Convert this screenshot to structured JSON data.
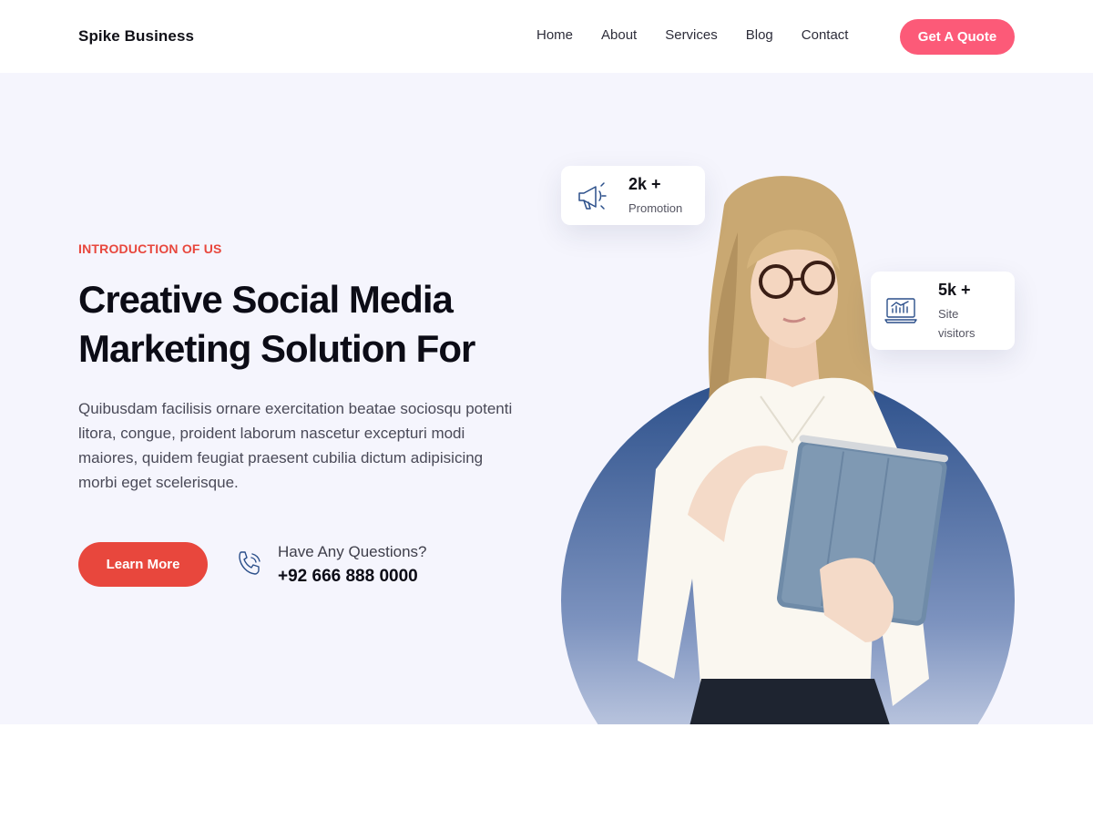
{
  "header": {
    "brand": "Spike Business",
    "nav": [
      "Home",
      "About",
      "Services",
      "Blog",
      "Contact"
    ],
    "cta": "Get A Quote"
  },
  "hero": {
    "eyebrow": "INTRODUCTION OF US",
    "headline_line1": "Creative Social Media",
    "headline_line2": "Marketing Solution For",
    "description": "Quibusdam facilisis ornare exercitation beatae sociosqu potenti litora, congue, proident laborum nascetur excepturi modi maiores, quidem feugiat praesent cubilia dictum adipisicing morbi eget scelerisque.",
    "learn_more": "Learn More",
    "question": "Have Any Questions?",
    "phone": "+92 666 888 0000"
  },
  "stats": [
    {
      "value": "2k +",
      "label": "Promotion",
      "icon": "megaphone-icon"
    },
    {
      "value": "5k +",
      "label": "Site visitors",
      "icon": "monitor-chart-icon"
    }
  ],
  "colors": {
    "accent_red": "#e8473d",
    "accent_pink": "#fc5a78",
    "hero_bg": "#f5f5fd",
    "circle_top": "#2b4f8a"
  }
}
